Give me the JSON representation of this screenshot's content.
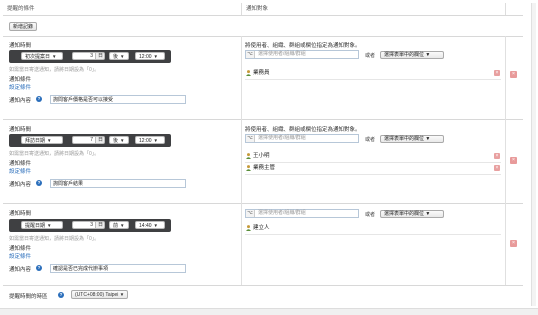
{
  "header": {
    "condition_col": "提醒的條件",
    "target_col": "通知對象"
  },
  "toolbar": {
    "new_record": "新增記錄"
  },
  "common": {
    "notify_time": "通知時間",
    "hint": "如需當日寄送通知，請將日期設為「0」。",
    "notify_condition": "通知條件",
    "set_condition": "設定條件",
    "notify_content": "通知內容",
    "target_hint": "將使用者、組織、群組或欄位指定為通知對象。",
    "picker_placeholder": "選擇使用者/組織/群組",
    "or": "或者",
    "field_select": "選擇表單中的欄位",
    "help": "?",
    "picker_icon": "⌥",
    "delete_icon": "×"
  },
  "reminders": [
    {
      "date_field": "初次提案日",
      "days": "3",
      "unit": "日",
      "direction": "後",
      "time": "12:00",
      "content": "詢問客戶價格是否可以接受",
      "show_target_hint": true,
      "recipients": [
        "業務員"
      ]
    },
    {
      "date_field": "拜訪日期",
      "days": "7",
      "unit": "日",
      "direction": "後",
      "time": "12:00",
      "content": "詢問客戶結果",
      "show_target_hint": true,
      "recipients": [
        "王小明",
        "業務主管"
      ]
    },
    {
      "date_field": "提醒日期",
      "days": "3",
      "unit": "日",
      "direction": "前",
      "time": "14:40",
      "content": "確認是否已完成代辦事項",
      "show_target_hint": false,
      "recipients": [
        "建立人"
      ]
    }
  ],
  "footer": {
    "timezone_label": "提醒時間的時區",
    "timezone_value": "(UTC+08:00) Taipei"
  },
  "colors": {
    "link": "#2a6ebb",
    "dark_bar": "#3f4042",
    "delete": "#e89a9a"
  }
}
